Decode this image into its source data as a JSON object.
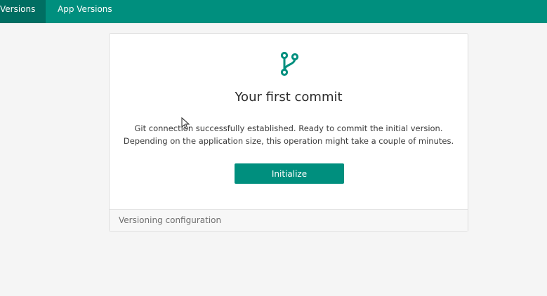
{
  "topbar": {
    "tabs": [
      {
        "label": "Versions",
        "active": true
      },
      {
        "label": "App Versions",
        "active": false
      }
    ],
    "color": "#008f7e",
    "active_tab_color": "#006e62"
  },
  "card": {
    "icon": "git-branch-icon",
    "title": "Your first commit",
    "description": "Git connection successfully established. Ready to commit the initial version. Depending on the application size, this operation might take a couple of minutes.",
    "button_label": "Initialize",
    "footer_label": "Versioning configuration"
  },
  "colors": {
    "accent": "#008f7e"
  }
}
